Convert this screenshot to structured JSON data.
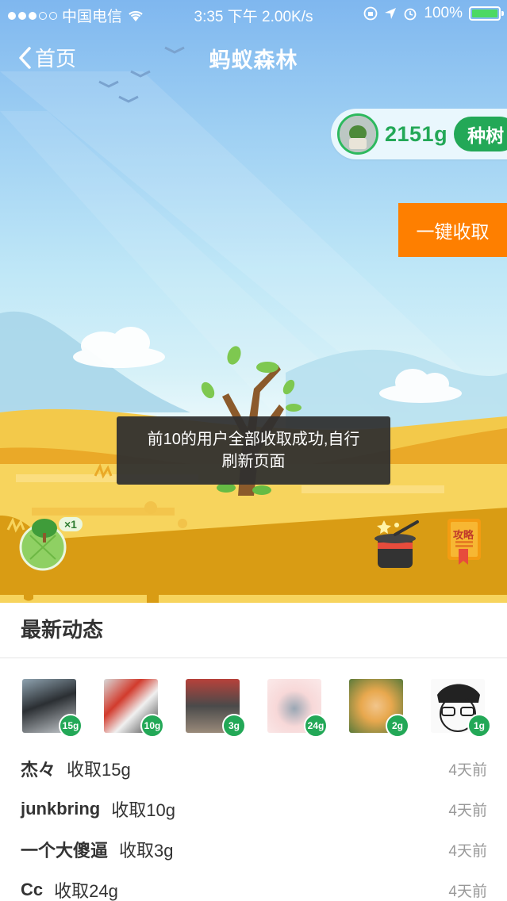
{
  "status_bar": {
    "carrier": "中国电信",
    "time": "3:35 下午",
    "speed": "2.00K/s",
    "battery": "100%"
  },
  "nav": {
    "back_label": "首页",
    "title": "蚂蚁森林"
  },
  "energy": {
    "value": "2151g",
    "plant_label": "种树"
  },
  "collect_all_label": "一键收取",
  "toast": {
    "line1": "前10的用户全部收取成功,自行",
    "line2": "刷新页面"
  },
  "tree_badge": {
    "count": "×1"
  },
  "guide_label": "攻略",
  "feed": {
    "title": "最新动态",
    "friends": [
      {
        "grams": "15g"
      },
      {
        "grams": "10g"
      },
      {
        "grams": "3g"
      },
      {
        "grams": "24g"
      },
      {
        "grams": "2g"
      },
      {
        "grams": "1g"
      }
    ],
    "items": [
      {
        "name": "杰々",
        "action": "收取15g",
        "time": "4天前"
      },
      {
        "name": "junkbring",
        "action": "收取10g",
        "time": "4天前"
      },
      {
        "name": "一个大傻逼",
        "action": "收取3g",
        "time": "4天前"
      },
      {
        "name": "Cc",
        "action": "收取24g",
        "time": "4天前"
      }
    ]
  },
  "colors": {
    "accent_green": "#23a857",
    "collect_orange": "#fe7f00",
    "ground_gold": "#d99c14"
  }
}
